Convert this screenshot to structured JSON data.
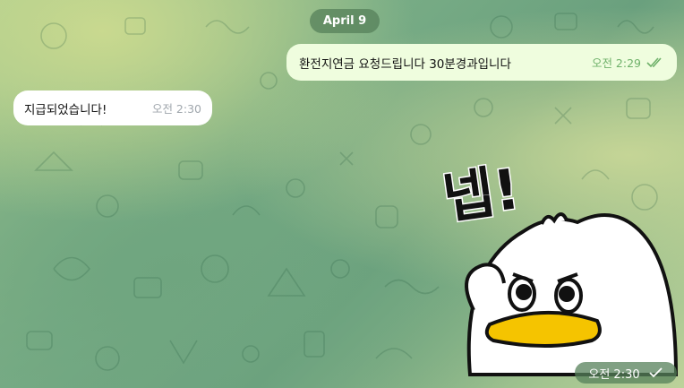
{
  "chat": {
    "date_label": "April 9",
    "messages": [
      {
        "direction": "outgoing",
        "text": "환전지연금 요청드립니다 30분경과입니다",
        "time": "오전 2:29",
        "status": "read"
      },
      {
        "direction": "incoming",
        "text": "지급되었습니다!",
        "time": "오전 2:30"
      },
      {
        "direction": "incoming",
        "type": "sticker",
        "sticker_text": "넵!",
        "time": "오전 2:30",
        "status": "sent"
      }
    ]
  },
  "colors": {
    "outgoing_bubble": "#effdde",
    "incoming_bubble": "#ffffff",
    "read_check": "#6fb16a",
    "sticker_beak": "#f5c400"
  }
}
